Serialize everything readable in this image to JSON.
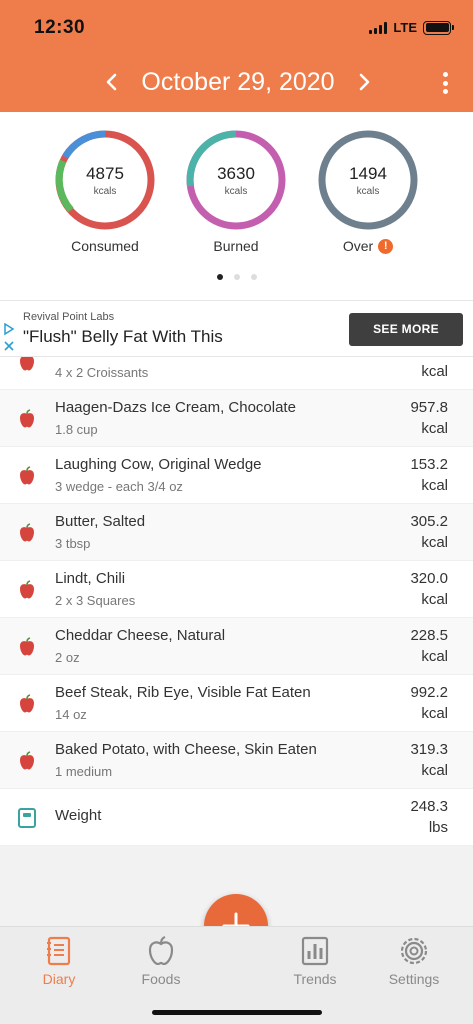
{
  "status_bar": {
    "time": "12:30",
    "network": "LTE"
  },
  "header": {
    "date": "October 29, 2020"
  },
  "summary": [
    {
      "value": "4875",
      "unit": "kcals",
      "label": "Consumed"
    },
    {
      "value": "3630",
      "unit": "kcals",
      "label": "Burned"
    },
    {
      "value": "1494",
      "unit": "kcals",
      "label": "Over",
      "badge": "!"
    }
  ],
  "ad": {
    "sponsor": "Revival Point Labs",
    "headline": "\"Flush\" Belly Fat With This",
    "cta": "SEE MORE"
  },
  "entries": [
    {
      "name": "",
      "serving": "4 x 2 Croissants",
      "value": "",
      "unit": "kcal",
      "icon": "apple-icon"
    },
    {
      "name": "Haagen-Dazs Ice Cream, Chocolate",
      "serving": "1.8 cup",
      "value": "957.8",
      "unit": "kcal",
      "icon": "apple-icon"
    },
    {
      "name": "Laughing Cow, Original Wedge",
      "serving": "3 wedge - each 3/4 oz",
      "value": "153.2",
      "unit": "kcal",
      "icon": "apple-icon"
    },
    {
      "name": "Butter, Salted",
      "serving": "3 tbsp",
      "value": "305.2",
      "unit": "kcal",
      "icon": "apple-icon"
    },
    {
      "name": "Lindt, Chili",
      "serving": "2 x 3 Squares",
      "value": "320.0",
      "unit": "kcal",
      "icon": "apple-icon"
    },
    {
      "name": "Cheddar Cheese, Natural",
      "serving": "2 oz",
      "value": "228.5",
      "unit": "kcal",
      "icon": "apple-icon"
    },
    {
      "name": "Beef Steak, Rib Eye, Visible Fat Eaten",
      "serving": "14 oz",
      "value": "992.2",
      "unit": "kcal",
      "icon": "apple-icon"
    },
    {
      "name": "Baked Potato, with Cheese, Skin Eaten",
      "serving": "1 medium",
      "value": "319.3",
      "unit": "kcal",
      "icon": "apple-icon"
    },
    {
      "name": "Weight",
      "serving": "",
      "value": "248.3",
      "unit": "lbs",
      "icon": "scale-icon"
    }
  ],
  "tabs": [
    {
      "label": "Diary",
      "icon": "diary-icon",
      "active": true
    },
    {
      "label": "Foods",
      "icon": "apple-icon",
      "active": false
    },
    {
      "label": "Trends",
      "icon": "bar-chart-icon",
      "active": false
    },
    {
      "label": "Settings",
      "icon": "gear-icon",
      "active": false
    }
  ],
  "colors": {
    "brand": "#ef7d4b",
    "consumed_ring": [
      "#4a90d9",
      "#d9534f",
      "#5cb85c"
    ],
    "burned_ring": [
      "#4bb3a8",
      "#c45fb0"
    ],
    "over_ring": "#6e7f8d"
  }
}
